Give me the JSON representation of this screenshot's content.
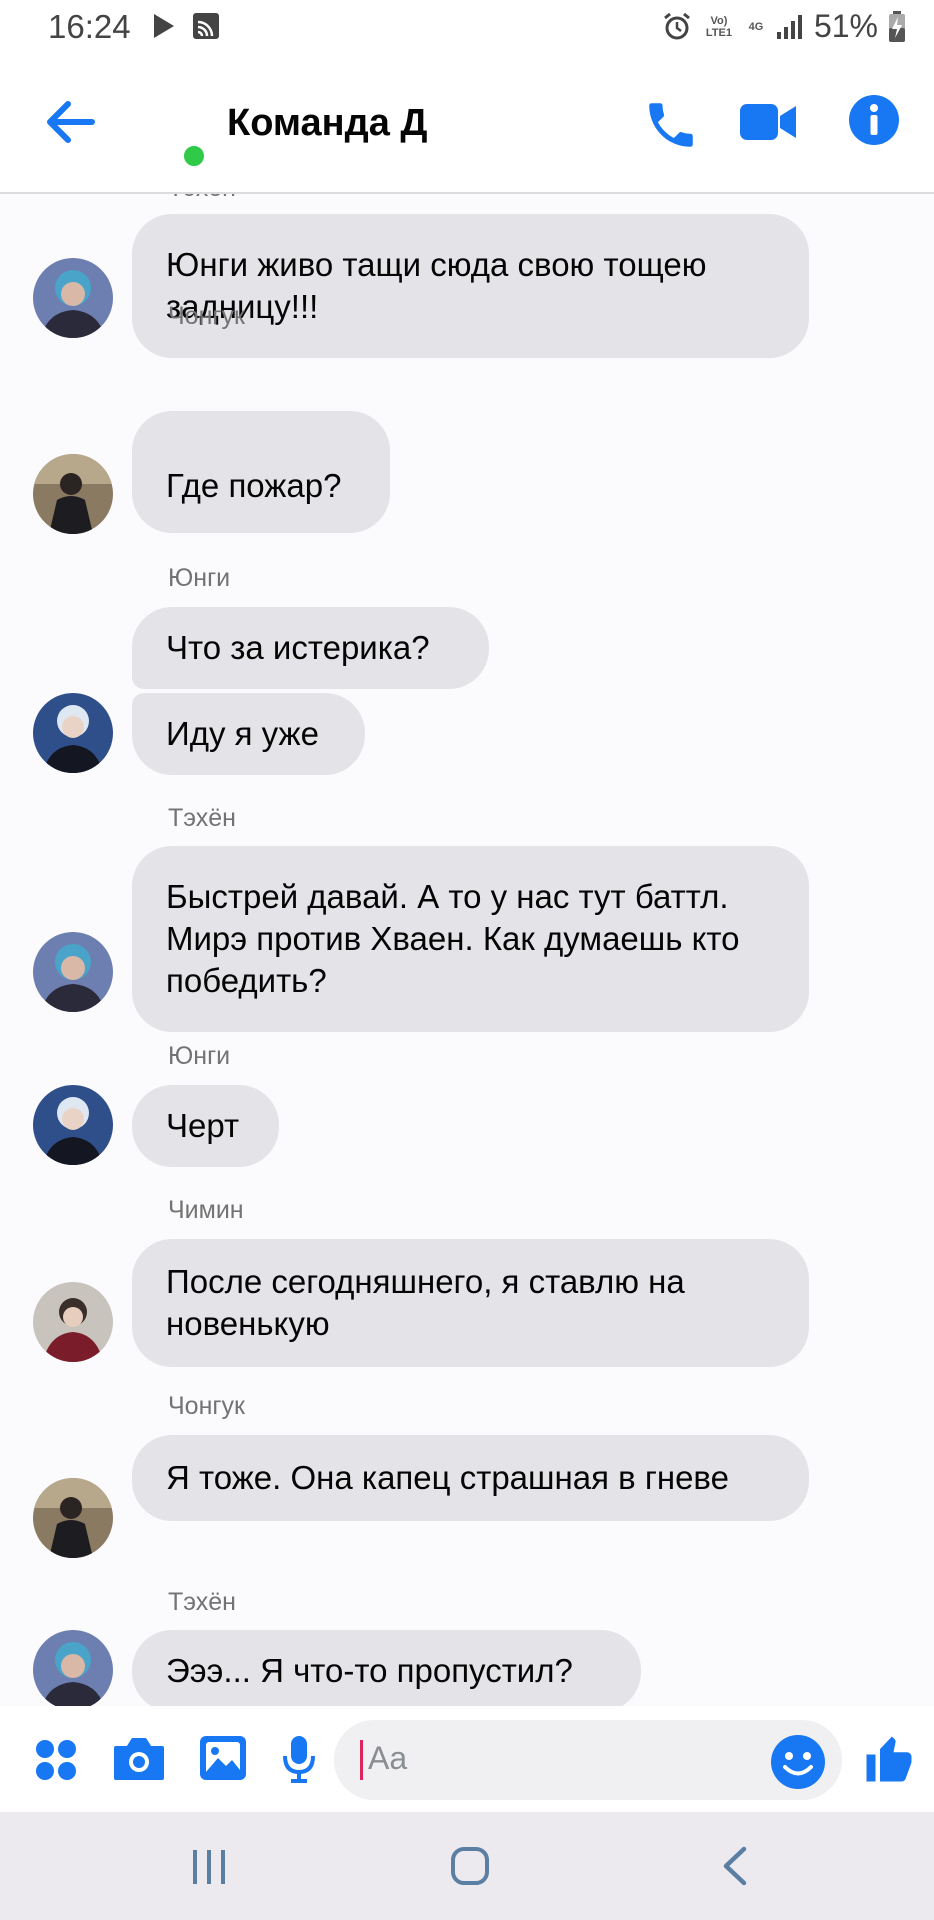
{
  "status": {
    "time": "16:24",
    "lte": "Vo) LTE1",
    "net": "4G",
    "battery": "51%"
  },
  "header": {
    "title": "Команда Д"
  },
  "messages": [
    {
      "sender": "Тэхён",
      "text": "Юнги живо тащи сюда свою тощею задницу!!!"
    },
    {
      "sender": "Чонгук",
      "text": "Где пожар?"
    },
    {
      "sender": "Юнги",
      "text": "Что за истерика?"
    },
    {
      "text": "Иду я уже"
    },
    {
      "sender": "Тэхён",
      "text": "Быстрей давай. А то у нас тут баттл. Мирэ против Хваен. Как думаешь кто победить?"
    },
    {
      "sender": "Юнги",
      "text": "Черт"
    },
    {
      "sender": "Чимин",
      "text": "После сегодняшнего, я ставлю на новенькую"
    },
    {
      "sender": "Чонгук",
      "text": "Я тоже. Она капец страшная в гневе"
    },
    {
      "sender": "Тэхён",
      "text": "Эээ... Я что-то пропустил?"
    }
  ],
  "composer": {
    "placeholder": "Aa"
  },
  "colors": {
    "accent": "#1877f2",
    "bubble": "#e4e4e8",
    "online": "#31c948"
  },
  "icons": [
    "back-arrow-icon",
    "phone-icon",
    "video-camera-icon",
    "info-icon",
    "apps-icon",
    "camera-icon",
    "gallery-icon",
    "microphone-icon",
    "emoji-icon",
    "thumbs-up-icon",
    "recents-icon",
    "home-icon",
    "back-nav-icon"
  ]
}
